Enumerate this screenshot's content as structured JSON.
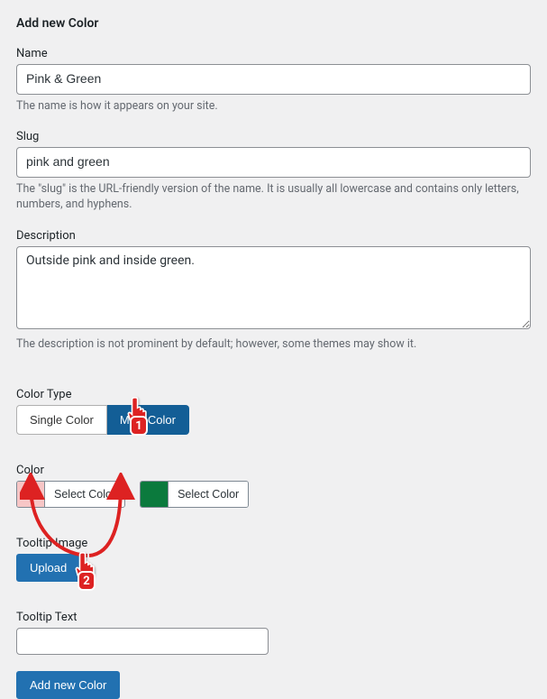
{
  "heading": "Add new Color",
  "fields": {
    "name": {
      "label": "Name",
      "value": "Pink & Green",
      "helper": "The name is how it appears on your site."
    },
    "slug": {
      "label": "Slug",
      "value": "pink and green",
      "helper": "The \"slug\" is the URL-friendly version of the name. It is usually all lowercase and contains only letters, numbers, and hyphens."
    },
    "description": {
      "label": "Description",
      "value": "Outside pink and inside green.",
      "helper": "The description is not prominent by default; however, some themes may show it."
    },
    "color_type": {
      "label": "Color Type",
      "option_single": "Single Color",
      "option_multi": "Multi Color",
      "selected": "Multi Color"
    },
    "color": {
      "label": "Color",
      "select_label": "Select Color",
      "swatches": [
        {
          "hex": "#f7c6c6",
          "name": "pink"
        },
        {
          "hex": "#0b7a3d",
          "name": "green"
        }
      ]
    },
    "tooltip_image": {
      "label": "Tooltip Image",
      "button": "Upload"
    },
    "tooltip_text": {
      "label": "Tooltip Text",
      "value": ""
    }
  },
  "submit_label": "Add new Color",
  "annotations": {
    "badge1": "1",
    "badge2": "2"
  }
}
